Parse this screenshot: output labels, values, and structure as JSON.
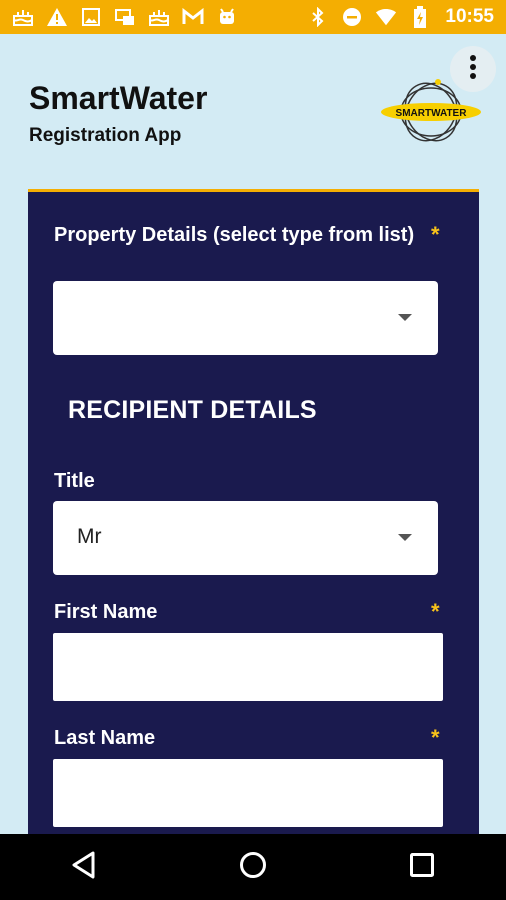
{
  "status_bar": {
    "time": "10:55",
    "left_icons": [
      "cake-icon",
      "warning-icon",
      "image-icon",
      "network-icon",
      "cake-icon",
      "gmail-icon",
      "android-icon"
    ],
    "right_icons": [
      "bluetooth-icon",
      "do-not-disturb-icon",
      "wifi-icon",
      "battery-charging-icon"
    ]
  },
  "header": {
    "title": "SmartWater",
    "subtitle": "Registration App",
    "logo_text": "SMARTWATER",
    "menu_icon": "more-vertical-icon"
  },
  "form": {
    "property_label": "Property Details (select type from list)",
    "property_required": "*",
    "property_value": "",
    "section_title": "RECIPIENT DETAILS",
    "title_label": "Title",
    "title_value": "Mr",
    "first_name_label": "First Name",
    "first_name_required": "*",
    "first_name_value": "",
    "last_name_label": "Last Name",
    "last_name_required": "*",
    "last_name_value": ""
  },
  "nav": {
    "back_icon": "back-icon",
    "home_icon": "home-icon",
    "recents_icon": "recents-icon"
  },
  "colors": {
    "status_bar": "#f4ae02",
    "background": "#d3ebf4",
    "card": "#1a1a4e",
    "required": "#f7c21a"
  }
}
